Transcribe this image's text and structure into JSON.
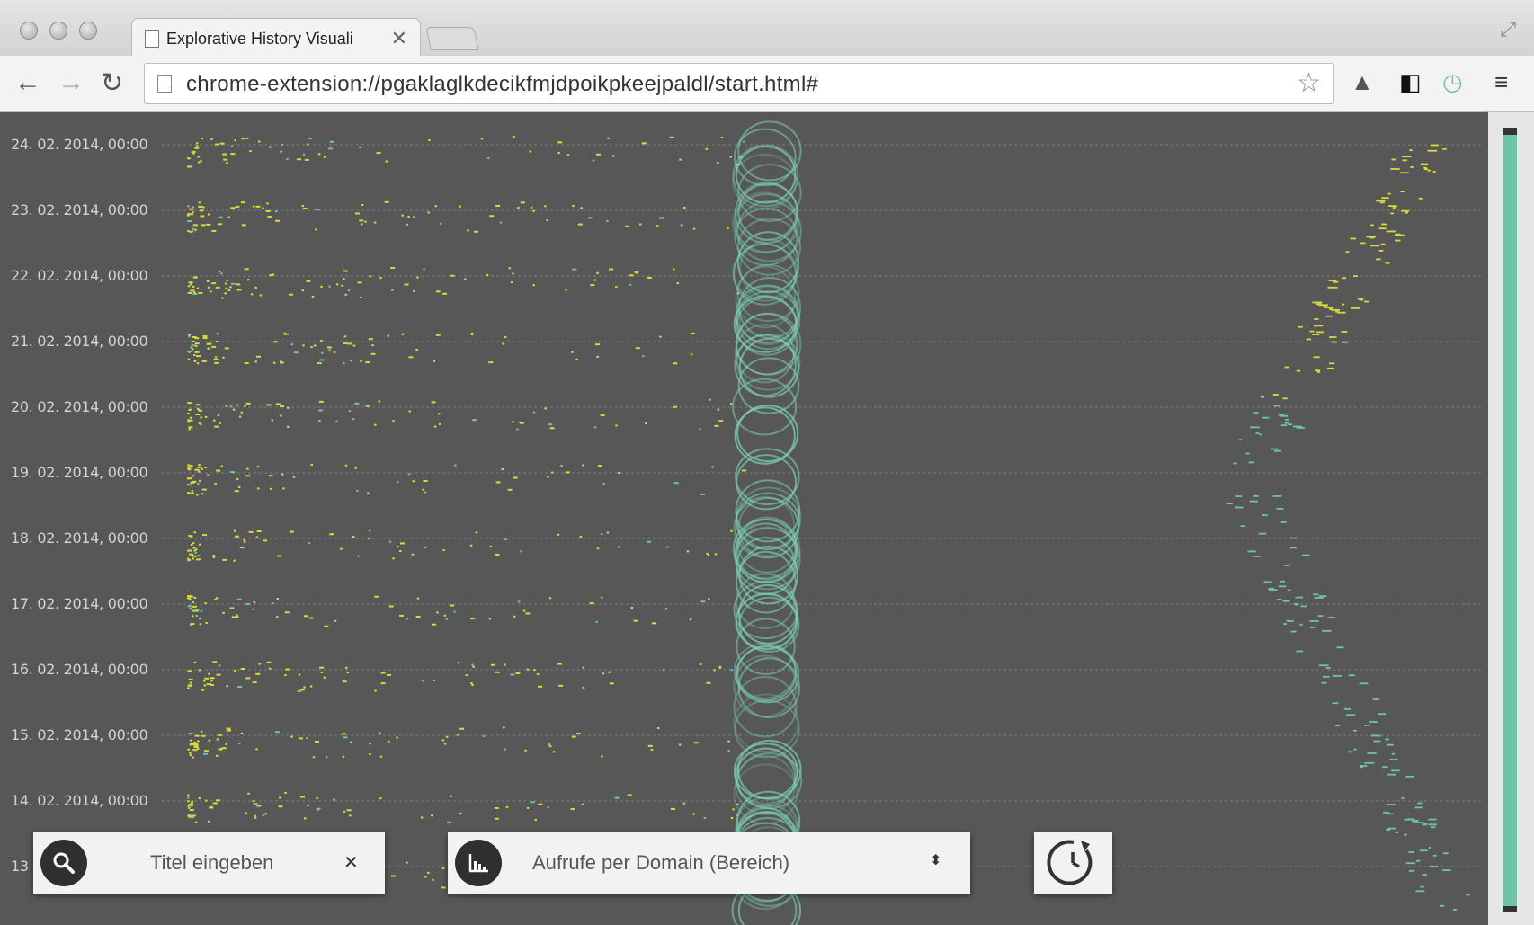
{
  "browser": {
    "tab_title": "Explorative History Visuali",
    "tab_close": "✕",
    "url": "chrome-extension://pgaklaglkdecikfmjdpoikpkeejpaldl/start.html#"
  },
  "viz": {
    "date_labels": [
      "24. 02. 2014, 00:00",
      "23. 02. 2014, 00:00",
      "22. 02. 2014, 00:00",
      "21. 02. 2014, 00:00",
      "20. 02. 2014, 00:00",
      "19. 02. 2014, 00:00",
      "18. 02. 2014, 00:00",
      "17. 02. 2014, 00:00",
      "16. 02. 2014, 00:00",
      "15. 02. 2014, 00:00",
      "14. 02. 2014, 00:00",
      "13"
    ],
    "colors": {
      "dots_old": "#d6db3a",
      "dots_recent": "#6fc3a6",
      "circles": "#7cd1b3",
      "grid": "#8a8a8a"
    }
  },
  "controls": {
    "search_placeholder": "Titel eingeben",
    "search_clear": "✕",
    "mode_label": "Aufrufe per Domain (Bereich)",
    "mode_arrow": "⬍"
  },
  "icons": {
    "search": "search-icon",
    "chart": "bar-chart-icon",
    "history": "history-clock-icon"
  }
}
